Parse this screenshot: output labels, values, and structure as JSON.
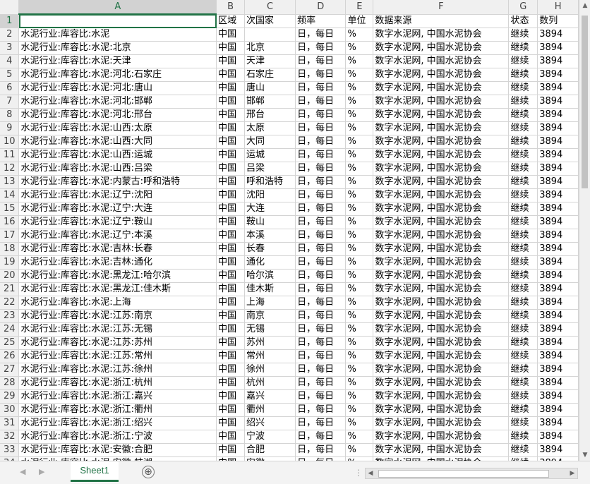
{
  "columns": [
    "A",
    "B",
    "C",
    "D",
    "E",
    "F",
    "G",
    "H"
  ],
  "header_row": {
    "row": "1",
    "A": "",
    "B": "区域",
    "C": "次国家",
    "D": "频率",
    "E": "单位",
    "F": "数据来源",
    "G": "状态",
    "H": "数列"
  },
  "rows": [
    [
      "2",
      "水泥行业:库容比:水泥",
      "中国",
      "",
      "日，每日",
      "%",
      "数字水泥网, 中国水泥协会",
      "继续",
      "3894"
    ],
    [
      "3",
      "水泥行业:库容比:水泥:北京",
      "中国",
      "北京",
      "日，每日",
      "%",
      "数字水泥网, 中国水泥协会",
      "继续",
      "3894"
    ],
    [
      "4",
      "水泥行业:库容比:水泥:天津",
      "中国",
      "天津",
      "日，每日",
      "%",
      "数字水泥网, 中国水泥协会",
      "继续",
      "3894"
    ],
    [
      "5",
      "水泥行业:库容比:水泥:河北:石家庄",
      "中国",
      "石家庄",
      "日，每日",
      "%",
      "数字水泥网, 中国水泥协会",
      "继续",
      "3894"
    ],
    [
      "6",
      "水泥行业:库容比:水泥:河北:唐山",
      "中国",
      "唐山",
      "日，每日",
      "%",
      "数字水泥网, 中国水泥协会",
      "继续",
      "3894"
    ],
    [
      "7",
      "水泥行业:库容比:水泥:河北:邯郸",
      "中国",
      "邯郸",
      "日，每日",
      "%",
      "数字水泥网, 中国水泥协会",
      "继续",
      "3894"
    ],
    [
      "8",
      "水泥行业:库容比:水泥:河北:邢台",
      "中国",
      "邢台",
      "日，每日",
      "%",
      "数字水泥网, 中国水泥协会",
      "继续",
      "3894"
    ],
    [
      "9",
      "水泥行业:库容比:水泥:山西:太原",
      "中国",
      "太原",
      "日，每日",
      "%",
      "数字水泥网, 中国水泥协会",
      "继续",
      "3894"
    ],
    [
      "10",
      "水泥行业:库容比:水泥:山西:大同",
      "中国",
      "大同",
      "日，每日",
      "%",
      "数字水泥网, 中国水泥协会",
      "继续",
      "3894"
    ],
    [
      "11",
      "水泥行业:库容比:水泥:山西:运城",
      "中国",
      "运城",
      "日，每日",
      "%",
      "数字水泥网, 中国水泥协会",
      "继续",
      "3894"
    ],
    [
      "12",
      "水泥行业:库容比:水泥:山西:吕梁",
      "中国",
      "吕梁",
      "日，每日",
      "%",
      "数字水泥网, 中国水泥协会",
      "继续",
      "3894"
    ],
    [
      "13",
      "水泥行业:库容比:水泥:内蒙古:呼和浩特",
      "中国",
      "呼和浩特",
      "日，每日",
      "%",
      "数字水泥网, 中国水泥协会",
      "继续",
      "3894"
    ],
    [
      "14",
      "水泥行业:库容比:水泥:辽宁:沈阳",
      "中国",
      "沈阳",
      "日，每日",
      "%",
      "数字水泥网, 中国水泥协会",
      "继续",
      "3894"
    ],
    [
      "15",
      "水泥行业:库容比:水泥:辽宁:大连",
      "中国",
      "大连",
      "日，每日",
      "%",
      "数字水泥网, 中国水泥协会",
      "继续",
      "3894"
    ],
    [
      "16",
      "水泥行业:库容比:水泥:辽宁:鞍山",
      "中国",
      "鞍山",
      "日，每日",
      "%",
      "数字水泥网, 中国水泥协会",
      "继续",
      "3894"
    ],
    [
      "17",
      "水泥行业:库容比:水泥:辽宁:本溪",
      "中国",
      "本溪",
      "日，每日",
      "%",
      "数字水泥网, 中国水泥协会",
      "继续",
      "3894"
    ],
    [
      "18",
      "水泥行业:库容比:水泥:吉林:长春",
      "中国",
      "长春",
      "日，每日",
      "%",
      "数字水泥网, 中国水泥协会",
      "继续",
      "3894"
    ],
    [
      "19",
      "水泥行业:库容比:水泥:吉林:通化",
      "中国",
      "通化",
      "日，每日",
      "%",
      "数字水泥网, 中国水泥协会",
      "继续",
      "3894"
    ],
    [
      "20",
      "水泥行业:库容比:水泥:黑龙江:哈尔滨",
      "中国",
      "哈尔滨",
      "日，每日",
      "%",
      "数字水泥网, 中国水泥协会",
      "继续",
      "3894"
    ],
    [
      "21",
      "水泥行业:库容比:水泥:黑龙江:佳木斯",
      "中国",
      "佳木斯",
      "日，每日",
      "%",
      "数字水泥网, 中国水泥协会",
      "继续",
      "3894"
    ],
    [
      "22",
      "水泥行业:库容比:水泥:上海",
      "中国",
      "上海",
      "日，每日",
      "%",
      "数字水泥网, 中国水泥协会",
      "继续",
      "3894"
    ],
    [
      "23",
      "水泥行业:库容比:水泥:江苏:南京",
      "中国",
      "南京",
      "日，每日",
      "%",
      "数字水泥网, 中国水泥协会",
      "继续",
      "3894"
    ],
    [
      "24",
      "水泥行业:库容比:水泥:江苏:无锡",
      "中国",
      "无锡",
      "日，每日",
      "%",
      "数字水泥网, 中国水泥协会",
      "继续",
      "3894"
    ],
    [
      "25",
      "水泥行业:库容比:水泥:江苏:苏州",
      "中国",
      "苏州",
      "日，每日",
      "%",
      "数字水泥网, 中国水泥协会",
      "继续",
      "3894"
    ],
    [
      "26",
      "水泥行业:库容比:水泥:江苏:常州",
      "中国",
      "常州",
      "日，每日",
      "%",
      "数字水泥网, 中国水泥协会",
      "继续",
      "3894"
    ],
    [
      "27",
      "水泥行业:库容比:水泥:江苏:徐州",
      "中国",
      "徐州",
      "日，每日",
      "%",
      "数字水泥网, 中国水泥协会",
      "继续",
      "3894"
    ],
    [
      "28",
      "水泥行业:库容比:水泥:浙江:杭州",
      "中国",
      "杭州",
      "日，每日",
      "%",
      "数字水泥网, 中国水泥协会",
      "继续",
      "3894"
    ],
    [
      "29",
      "水泥行业:库容比:水泥:浙江:嘉兴",
      "中国",
      "嘉兴",
      "日，每日",
      "%",
      "数字水泥网, 中国水泥协会",
      "继续",
      "3894"
    ],
    [
      "30",
      "水泥行业:库容比:水泥:浙江:衢州",
      "中国",
      "衢州",
      "日，每日",
      "%",
      "数字水泥网, 中国水泥协会",
      "继续",
      "3894"
    ],
    [
      "31",
      "水泥行业:库容比:水泥:浙江:绍兴",
      "中国",
      "绍兴",
      "日，每日",
      "%",
      "数字水泥网, 中国水泥协会",
      "继续",
      "3894"
    ],
    [
      "32",
      "水泥行业:库容比:水泥:浙江:宁波",
      "中国",
      "宁波",
      "日，每日",
      "%",
      "数字水泥网, 中国水泥协会",
      "继续",
      "3894"
    ],
    [
      "33",
      "水泥行业:库容比:水泥:安徽:合肥",
      "中国",
      "合肥",
      "日，每日",
      "%",
      "数字水泥网, 中国水泥协会",
      "继续",
      "3894"
    ],
    [
      "34",
      "水泥行业:库容比:水泥:安徽:蚌湖",
      "中国",
      "安徽",
      "日，每日",
      "%",
      "数字水泥网, 中国水泥协会",
      "继续",
      "3894"
    ]
  ],
  "sheet_tab": "Sheet1",
  "add_sheet_icon": "⊕",
  "colors": {
    "accent": "#217346",
    "grid": "#d4d4d4",
    "header_bg": "#f0f0f0"
  }
}
